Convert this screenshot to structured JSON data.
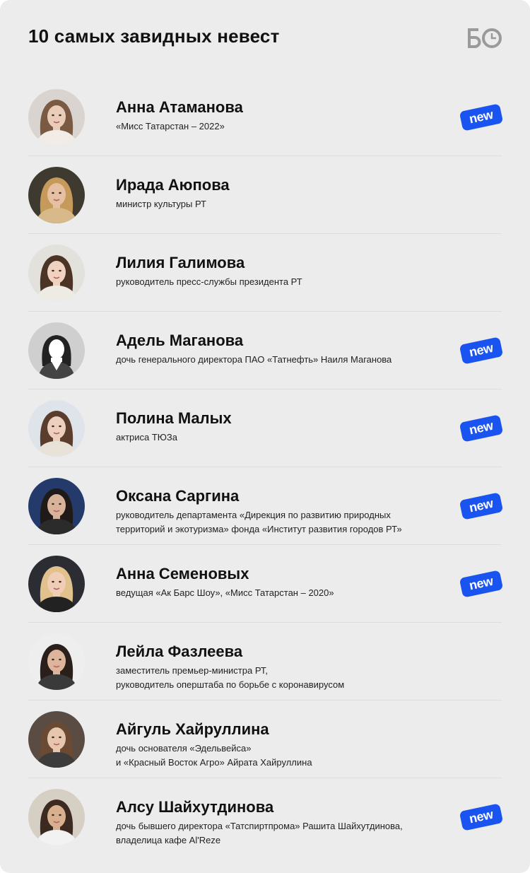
{
  "header": {
    "title": "10 самых завидных невест",
    "logo_text": "БО",
    "logo_color": "#9a9a9a"
  },
  "colors": {
    "background": "#ececec",
    "badge": "#1a54f0",
    "divider": "#dddddd"
  },
  "people": [
    {
      "name": "Анна Атаманова",
      "desc": [
        "«Мисс Татарстан – 2022»"
      ],
      "badge": "new"
    },
    {
      "name": "Ирада Аюпова",
      "desc": [
        "министр культуры РТ"
      ],
      "badge": ""
    },
    {
      "name": "Лилия Галимова",
      "desc": [
        "руководитель пресс-службы президента РТ"
      ],
      "badge": ""
    },
    {
      "name": "Адель Маганова",
      "desc": [
        "дочь генерального директора ПАО «Татнефть» Наиля Маганова"
      ],
      "badge": "new"
    },
    {
      "name": "Полина Малых",
      "desc": [
        "актриса ТЮЗа"
      ],
      "badge": "new"
    },
    {
      "name": "Оксана Саргина",
      "desc": [
        "руководитель департамента «Дирекция по развитию природных",
        "территорий и экотуризма» фонда «Институт развития городов РТ»"
      ],
      "badge": "new"
    },
    {
      "name": "Анна Семеновых",
      "desc": [
        "ведущая «Ак Барс Шоу», «Мисс Татарстан – 2020»"
      ],
      "badge": "new"
    },
    {
      "name": "Лейла Фазлеева",
      "desc": [
        "заместитель премьер-министра РТ,",
        "руководитель оперштаба по борьбе с коронавирусом"
      ],
      "badge": ""
    },
    {
      "name": "Айгуль Хайруллина",
      "desc": [
        "дочь основателя «Эдельвейса»",
        "и «Красный Восток Агро» Айрата Хайруллина"
      ],
      "badge": ""
    },
    {
      "name": "Алсу Шайхутдинова",
      "desc": [
        "дочь бывшего директора «Татспиртпрома» Рашита Шайхутдинова,",
        "владелица кафе Al'Reze"
      ],
      "badge": "new"
    }
  ]
}
